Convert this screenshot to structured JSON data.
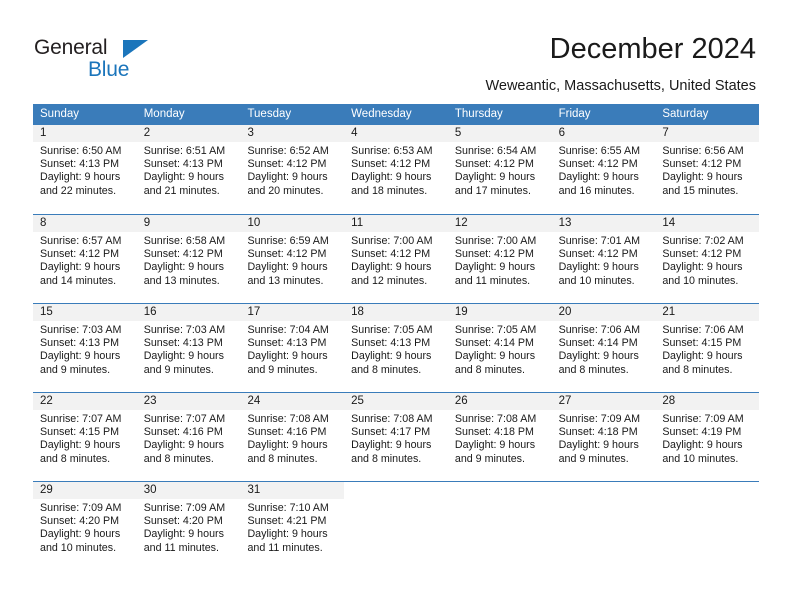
{
  "brand": {
    "name_part1": "General",
    "name_part2": "Blue",
    "accent_color": "#1b75bb"
  },
  "header": {
    "title": "December 2024",
    "subtitle": "Weweantic, Massachusetts, United States"
  },
  "calendar": {
    "header_color": "#3a7cba",
    "weekdays": [
      "Sunday",
      "Monday",
      "Tuesday",
      "Wednesday",
      "Thursday",
      "Friday",
      "Saturday"
    ],
    "weeks": [
      [
        {
          "day": "1",
          "sunrise": "Sunrise: 6:50 AM",
          "sunset": "Sunset: 4:13 PM",
          "daylight1": "Daylight: 9 hours",
          "daylight2": "and 22 minutes."
        },
        {
          "day": "2",
          "sunrise": "Sunrise: 6:51 AM",
          "sunset": "Sunset: 4:13 PM",
          "daylight1": "Daylight: 9 hours",
          "daylight2": "and 21 minutes."
        },
        {
          "day": "3",
          "sunrise": "Sunrise: 6:52 AM",
          "sunset": "Sunset: 4:12 PM",
          "daylight1": "Daylight: 9 hours",
          "daylight2": "and 20 minutes."
        },
        {
          "day": "4",
          "sunrise": "Sunrise: 6:53 AM",
          "sunset": "Sunset: 4:12 PM",
          "daylight1": "Daylight: 9 hours",
          "daylight2": "and 18 minutes."
        },
        {
          "day": "5",
          "sunrise": "Sunrise: 6:54 AM",
          "sunset": "Sunset: 4:12 PM",
          "daylight1": "Daylight: 9 hours",
          "daylight2": "and 17 minutes."
        },
        {
          "day": "6",
          "sunrise": "Sunrise: 6:55 AM",
          "sunset": "Sunset: 4:12 PM",
          "daylight1": "Daylight: 9 hours",
          "daylight2": "and 16 minutes."
        },
        {
          "day": "7",
          "sunrise": "Sunrise: 6:56 AM",
          "sunset": "Sunset: 4:12 PM",
          "daylight1": "Daylight: 9 hours",
          "daylight2": "and 15 minutes."
        }
      ],
      [
        {
          "day": "8",
          "sunrise": "Sunrise: 6:57 AM",
          "sunset": "Sunset: 4:12 PM",
          "daylight1": "Daylight: 9 hours",
          "daylight2": "and 14 minutes."
        },
        {
          "day": "9",
          "sunrise": "Sunrise: 6:58 AM",
          "sunset": "Sunset: 4:12 PM",
          "daylight1": "Daylight: 9 hours",
          "daylight2": "and 13 minutes."
        },
        {
          "day": "10",
          "sunrise": "Sunrise: 6:59 AM",
          "sunset": "Sunset: 4:12 PM",
          "daylight1": "Daylight: 9 hours",
          "daylight2": "and 13 minutes."
        },
        {
          "day": "11",
          "sunrise": "Sunrise: 7:00 AM",
          "sunset": "Sunset: 4:12 PM",
          "daylight1": "Daylight: 9 hours",
          "daylight2": "and 12 minutes."
        },
        {
          "day": "12",
          "sunrise": "Sunrise: 7:00 AM",
          "sunset": "Sunset: 4:12 PM",
          "daylight1": "Daylight: 9 hours",
          "daylight2": "and 11 minutes."
        },
        {
          "day": "13",
          "sunrise": "Sunrise: 7:01 AM",
          "sunset": "Sunset: 4:12 PM",
          "daylight1": "Daylight: 9 hours",
          "daylight2": "and 10 minutes."
        },
        {
          "day": "14",
          "sunrise": "Sunrise: 7:02 AM",
          "sunset": "Sunset: 4:12 PM",
          "daylight1": "Daylight: 9 hours",
          "daylight2": "and 10 minutes."
        }
      ],
      [
        {
          "day": "15",
          "sunrise": "Sunrise: 7:03 AM",
          "sunset": "Sunset: 4:13 PM",
          "daylight1": "Daylight: 9 hours",
          "daylight2": "and 9 minutes."
        },
        {
          "day": "16",
          "sunrise": "Sunrise: 7:03 AM",
          "sunset": "Sunset: 4:13 PM",
          "daylight1": "Daylight: 9 hours",
          "daylight2": "and 9 minutes."
        },
        {
          "day": "17",
          "sunrise": "Sunrise: 7:04 AM",
          "sunset": "Sunset: 4:13 PM",
          "daylight1": "Daylight: 9 hours",
          "daylight2": "and 9 minutes."
        },
        {
          "day": "18",
          "sunrise": "Sunrise: 7:05 AM",
          "sunset": "Sunset: 4:13 PM",
          "daylight1": "Daylight: 9 hours",
          "daylight2": "and 8 minutes."
        },
        {
          "day": "19",
          "sunrise": "Sunrise: 7:05 AM",
          "sunset": "Sunset: 4:14 PM",
          "daylight1": "Daylight: 9 hours",
          "daylight2": "and 8 minutes."
        },
        {
          "day": "20",
          "sunrise": "Sunrise: 7:06 AM",
          "sunset": "Sunset: 4:14 PM",
          "daylight1": "Daylight: 9 hours",
          "daylight2": "and 8 minutes."
        },
        {
          "day": "21",
          "sunrise": "Sunrise: 7:06 AM",
          "sunset": "Sunset: 4:15 PM",
          "daylight1": "Daylight: 9 hours",
          "daylight2": "and 8 minutes."
        }
      ],
      [
        {
          "day": "22",
          "sunrise": "Sunrise: 7:07 AM",
          "sunset": "Sunset: 4:15 PM",
          "daylight1": "Daylight: 9 hours",
          "daylight2": "and 8 minutes."
        },
        {
          "day": "23",
          "sunrise": "Sunrise: 7:07 AM",
          "sunset": "Sunset: 4:16 PM",
          "daylight1": "Daylight: 9 hours",
          "daylight2": "and 8 minutes."
        },
        {
          "day": "24",
          "sunrise": "Sunrise: 7:08 AM",
          "sunset": "Sunset: 4:16 PM",
          "daylight1": "Daylight: 9 hours",
          "daylight2": "and 8 minutes."
        },
        {
          "day": "25",
          "sunrise": "Sunrise: 7:08 AM",
          "sunset": "Sunset: 4:17 PM",
          "daylight1": "Daylight: 9 hours",
          "daylight2": "and 8 minutes."
        },
        {
          "day": "26",
          "sunrise": "Sunrise: 7:08 AM",
          "sunset": "Sunset: 4:18 PM",
          "daylight1": "Daylight: 9 hours",
          "daylight2": "and 9 minutes."
        },
        {
          "day": "27",
          "sunrise": "Sunrise: 7:09 AM",
          "sunset": "Sunset: 4:18 PM",
          "daylight1": "Daylight: 9 hours",
          "daylight2": "and 9 minutes."
        },
        {
          "day": "28",
          "sunrise": "Sunrise: 7:09 AM",
          "sunset": "Sunset: 4:19 PM",
          "daylight1": "Daylight: 9 hours",
          "daylight2": "and 10 minutes."
        }
      ],
      [
        {
          "day": "29",
          "sunrise": "Sunrise: 7:09 AM",
          "sunset": "Sunset: 4:20 PM",
          "daylight1": "Daylight: 9 hours",
          "daylight2": "and 10 minutes."
        },
        {
          "day": "30",
          "sunrise": "Sunrise: 7:09 AM",
          "sunset": "Sunset: 4:20 PM",
          "daylight1": "Daylight: 9 hours",
          "daylight2": "and 11 minutes."
        },
        {
          "day": "31",
          "sunrise": "Sunrise: 7:10 AM",
          "sunset": "Sunset: 4:21 PM",
          "daylight1": "Daylight: 9 hours",
          "daylight2": "and 11 minutes."
        },
        {
          "day": "",
          "sunrise": "",
          "sunset": "",
          "daylight1": "",
          "daylight2": ""
        },
        {
          "day": "",
          "sunrise": "",
          "sunset": "",
          "daylight1": "",
          "daylight2": ""
        },
        {
          "day": "",
          "sunrise": "",
          "sunset": "",
          "daylight1": "",
          "daylight2": ""
        },
        {
          "day": "",
          "sunrise": "",
          "sunset": "",
          "daylight1": "",
          "daylight2": ""
        }
      ]
    ]
  }
}
